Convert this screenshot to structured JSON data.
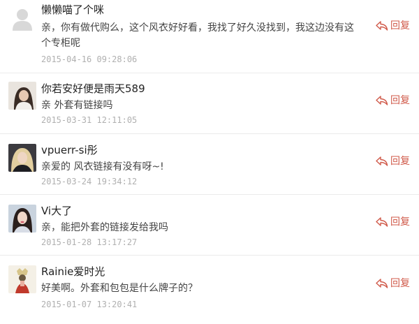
{
  "comments": [
    {
      "username": "懒懒喵了个咪",
      "text": "亲，你有做代购么，这个风衣好好看，我找了好久没找到，我这边没有这个专柜呢",
      "time": "2015-04-16 09:28:06",
      "reply_label": "回复"
    },
    {
      "username": "你若安好便是雨天589",
      "text": "亲 外套有链接吗",
      "time": "2015-03-31 12:11:05",
      "reply_label": "回复"
    },
    {
      "username": "vpuerr-si彤",
      "text": "亲爱的 风衣链接有没有呀~!",
      "time": "2015-03-24 19:34:12",
      "reply_label": "回复"
    },
    {
      "username": "Vi大了",
      "text": "亲，能把外套的链接发给我吗",
      "time": "2015-01-28 13:17:27",
      "reply_label": "回复"
    },
    {
      "username": "Rainie爱时光",
      "text": "好美啊。外套和包包是什么牌子的？",
      "time": "2015-01-07 13:20:41",
      "reply_label": "回复"
    }
  ],
  "colors": {
    "reply": "#d05a4a",
    "time": "#b0b0b0",
    "divider": "#ebebeb"
  }
}
